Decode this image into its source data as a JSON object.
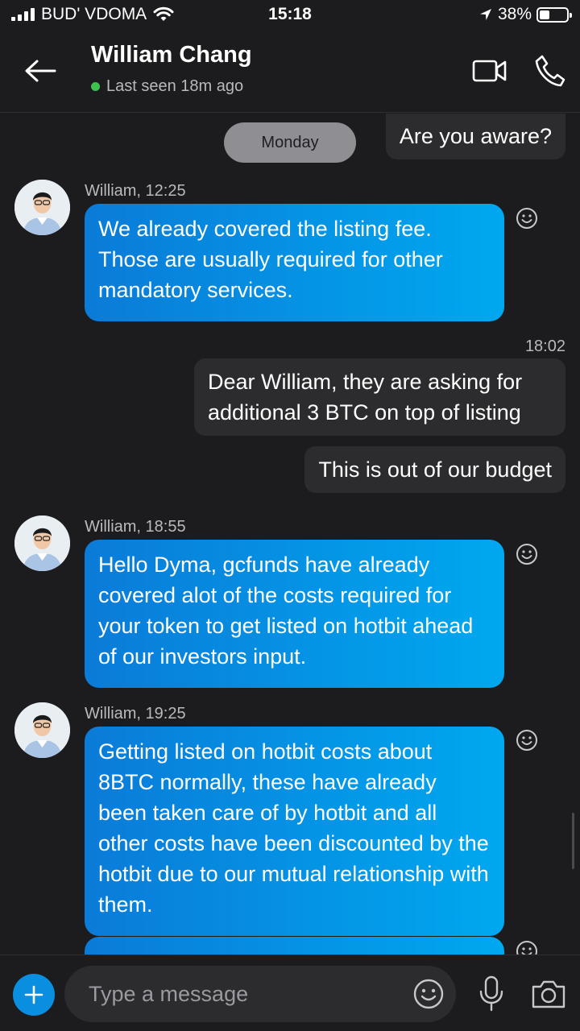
{
  "status_bar": {
    "carrier": "BUD' VDOMA",
    "time": "15:18",
    "battery": "38%",
    "battery_level": 0.38
  },
  "header": {
    "contact_name": "William Chang",
    "presence": "Last seen 18m ago",
    "icons": [
      "back-arrow-icon",
      "video-call-icon",
      "phone-icon"
    ]
  },
  "chat": {
    "day_separator": "Monday",
    "messages": [
      {
        "direction": "out",
        "text": "Are you aware?"
      },
      {
        "direction": "in",
        "meta": "William, 12:25",
        "text": "We already covered the listing fee. Those are usually required for other mandatory services."
      },
      {
        "direction": "out",
        "time": "18:02",
        "text": "Dear William, they are asking for additional 3 BTC on top of listing"
      },
      {
        "direction": "out",
        "text": "This is out of our budget"
      },
      {
        "direction": "in",
        "meta": "William, 18:55",
        "text": "Hello Dyma, gcfunds have already covered alot of the costs required for your token to get listed on hotbit ahead of our investors input."
      },
      {
        "direction": "in",
        "meta": "William, 19:25",
        "text": "Getting listed on hotbit costs about 8BTC normally, these have already been taken care of by hotbit and all other costs have been discounted by the hotbit due to our mutual relationship with them."
      },
      {
        "direction": "in",
        "text": ""
      }
    ]
  },
  "composer": {
    "placeholder": "Type a message",
    "icons": [
      "plus-icon",
      "emoji-icon",
      "microphone-icon",
      "camera-icon"
    ]
  },
  "colors": {
    "background": "#1c1c1e",
    "outgoing_bubble": "#2c2c2e",
    "incoming_bubble_start": "#0a7bd8",
    "incoming_bubble_end": "#00a8f0",
    "online": "#3cc14f",
    "accent": "#0a8ee0"
  }
}
